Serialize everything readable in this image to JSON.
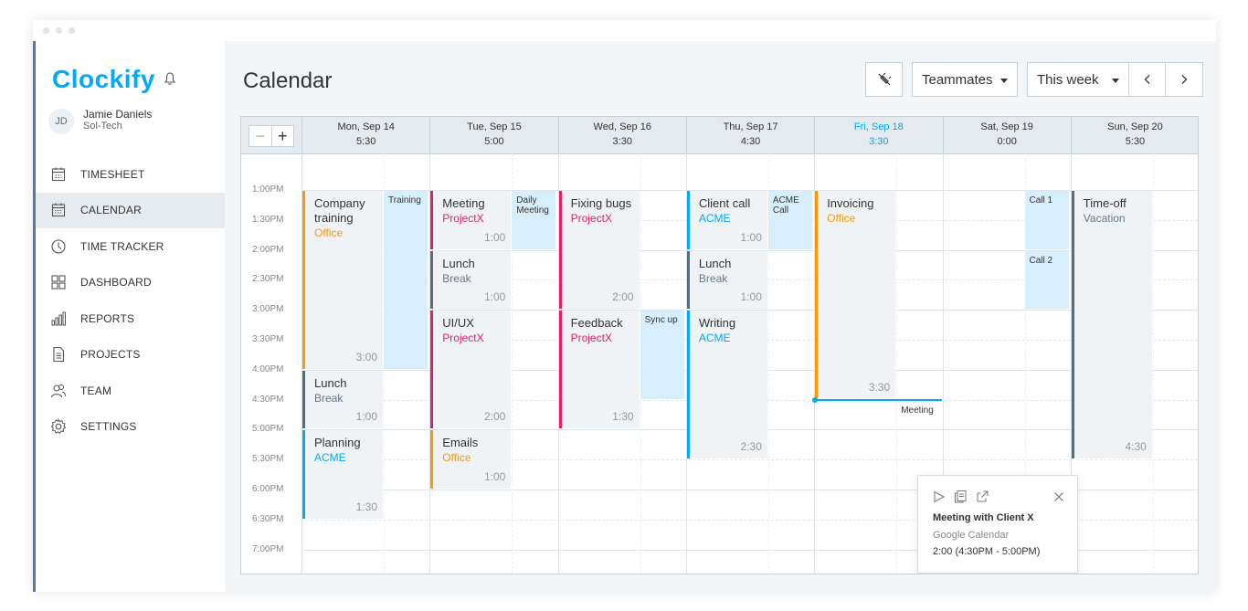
{
  "app": {
    "logo_text": "Clockify"
  },
  "user": {
    "initials": "JD",
    "name": "Jamie Daniels",
    "org": "Sol-Tech"
  },
  "sidebar": {
    "items": [
      {
        "label": "TIMESHEET",
        "icon": "timesheet-icon",
        "active": false
      },
      {
        "label": "CALENDAR",
        "icon": "calendar-icon",
        "active": true
      },
      {
        "label": "TIME TRACKER",
        "icon": "clock-icon",
        "active": false
      },
      {
        "label": "DASHBOARD",
        "icon": "dashboard-icon",
        "active": false
      },
      {
        "label": "REPORTS",
        "icon": "bar-chart-icon",
        "active": false
      },
      {
        "label": "PROJECTS",
        "icon": "document-icon",
        "active": false
      },
      {
        "label": "TEAM",
        "icon": "team-icon",
        "active": false
      },
      {
        "label": "SETTINGS",
        "icon": "gear-icon",
        "active": false
      }
    ]
  },
  "header": {
    "title": "Calendar",
    "teammates_label": "Teammates",
    "range_label": "This week"
  },
  "calendar": {
    "days": [
      {
        "name": "Mon, Sep 14",
        "total": "5:30",
        "today": false
      },
      {
        "name": "Tue, Sep 15",
        "total": "5:00",
        "today": false
      },
      {
        "name": "Wed, Sep 16",
        "total": "3:30",
        "today": false
      },
      {
        "name": "Thu, Sep 17",
        "total": "4:30",
        "today": false
      },
      {
        "name": "Fri, Sep 18",
        "total": "3:30",
        "today": true
      },
      {
        "name": "Sat, Sep 19",
        "total": "0:00",
        "today": false
      },
      {
        "name": "Sun, Sep 20",
        "total": "5:30",
        "today": false
      }
    ],
    "times": [
      "1:00PM",
      "1:30PM",
      "2:00PM",
      "2:30PM",
      "3:00PM",
      "3:30PM",
      "4:00PM",
      "4:30PM",
      "5:00PM",
      "5:30PM",
      "6:00PM",
      "6:30PM",
      "7:00PM"
    ],
    "entries": [
      {
        "day": 0,
        "start": "1:00PM",
        "end": "4:00PM",
        "title": "Company\ntraining",
        "project": "Office",
        "color": "#ff9800",
        "duration": "3:00"
      },
      {
        "day": 0,
        "start": "4:00PM",
        "end": "5:00PM",
        "title": "Lunch",
        "project": "Break",
        "color": "#5a6b7b",
        "duration": "1:00"
      },
      {
        "day": 0,
        "start": "5:00PM",
        "end": "6:30PM",
        "title": "Planning",
        "project": "ACME",
        "color": "#03a9f4",
        "duration": "1:30"
      },
      {
        "day": 1,
        "start": "1:00PM",
        "end": "2:00PM",
        "title": "Meeting",
        "project": "ProjectX",
        "color": "#e91e63",
        "duration": "1:00"
      },
      {
        "day": 1,
        "start": "2:00PM",
        "end": "3:00PM",
        "title": "Lunch",
        "project": "Break",
        "color": "#5a6b7b",
        "duration": "1:00"
      },
      {
        "day": 1,
        "start": "3:00PM",
        "end": "5:00PM",
        "title": "UI/UX",
        "project": "ProjectX",
        "color": "#e91e63",
        "duration": "2:00"
      },
      {
        "day": 1,
        "start": "5:00PM",
        "end": "6:00PM",
        "title": "Emails",
        "project": "Office",
        "color": "#ff9800",
        "duration": "1:00"
      },
      {
        "day": 2,
        "start": "1:00PM",
        "end": "3:00PM",
        "title": "Fixing bugs",
        "project": "ProjectX",
        "color": "#e91e63",
        "duration": "2:00"
      },
      {
        "day": 2,
        "start": "3:00PM",
        "end": "5:00PM",
        "title": "Feedback",
        "project": "ProjectX",
        "color": "#e91e63",
        "duration": "1:30"
      },
      {
        "day": 3,
        "start": "1:00PM",
        "end": "2:00PM",
        "title": "Client call",
        "project": "ACME",
        "color": "#03a9f4",
        "duration": "1:00"
      },
      {
        "day": 3,
        "start": "2:00PM",
        "end": "3:00PM",
        "title": "Lunch",
        "project": "Break",
        "color": "#5a6b7b",
        "duration": "1:00"
      },
      {
        "day": 3,
        "start": "3:00PM",
        "end": "5:30PM",
        "title": "Writing",
        "project": "ACME",
        "color": "#03a9f4",
        "duration": "2:30"
      },
      {
        "day": 4,
        "start": "1:00PM",
        "end": "4:30PM",
        "title": "Invoicing",
        "project": "Office",
        "color": "#ff9800",
        "duration": "3:30"
      },
      {
        "day": 6,
        "start": "1:00PM",
        "end": "5:30PM",
        "title": "Time-off",
        "project": "Vacation",
        "color": "#5a6b7b",
        "duration": "4:30"
      }
    ],
    "external_events": [
      {
        "day": 0,
        "start": "1:00PM",
        "end": "4:00PM",
        "title": "Training"
      },
      {
        "day": 1,
        "start": "1:00PM",
        "end": "2:00PM",
        "title": "Daily\nMeeting"
      },
      {
        "day": 2,
        "start": "3:00PM",
        "end": "4:30PM",
        "title": "Sync up"
      },
      {
        "day": 3,
        "start": "1:00PM",
        "end": "2:00PM",
        "title": "ACME\nCall"
      },
      {
        "day": 4,
        "start": "4:30PM",
        "end": "5:00PM",
        "title": "Meeting"
      },
      {
        "day": 5,
        "start": "1:00PM",
        "end": "2:00PM",
        "title": "Call 1"
      },
      {
        "day": 5,
        "start": "2:00PM",
        "end": "3:00PM",
        "title": "Call 2"
      }
    ],
    "popup": {
      "title": "Meeting with Client X",
      "source": "Google Calendar",
      "time": "2:00 (4:30PM - 5:00PM)"
    }
  }
}
